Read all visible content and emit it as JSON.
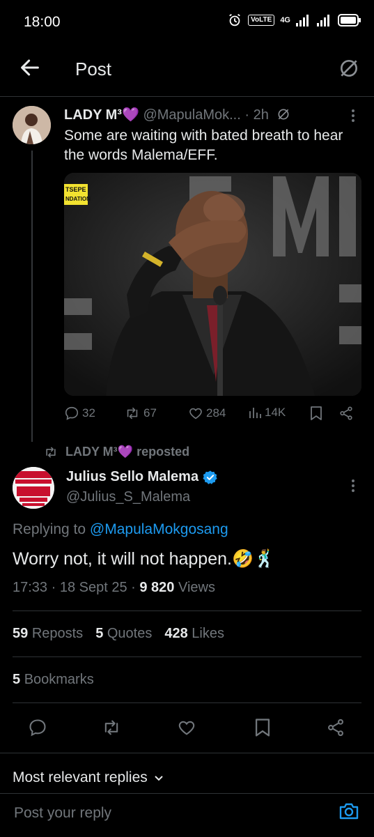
{
  "status": {
    "time": "18:00",
    "volte": "VoLTE",
    "net": "4G"
  },
  "header": {
    "title": "Post"
  },
  "parent": {
    "name": "LADY M³💜",
    "handle": "@MapulaMok...",
    "age": "· 2h",
    "text": "Some are waiting with bated breath to hear the words Malema/EFF.",
    "media_sign": "TSEPE\nNDATION",
    "replies": "32",
    "reposts": "67",
    "likes": "284",
    "views": "14K"
  },
  "repost_line": "LADY M³💜 reposted",
  "main": {
    "name": "Julius Sello Malema",
    "handle": "@Julius_S_Malema",
    "replying_prefix": "Replying to",
    "replying_to": "@MapulaMokgosang",
    "text": "Worry not, it will not happen.🤣🕺",
    "time": "17:33 · 18 Sept 25 ·",
    "views_num": "9 820",
    "views_label": "Views",
    "avatar_text": "EFF 10th ANNIVERSARY RALLY",
    "stats": {
      "reposts_num": "59",
      "reposts_label": "Reposts",
      "quotes_num": "5",
      "quotes_label": "Quotes",
      "likes_num": "428",
      "likes_label": "Likes"
    },
    "bookmarks_num": "5",
    "bookmarks_label": "Bookmarks"
  },
  "replies_filter": "Most relevant replies",
  "reply_placeholder": "Post your reply",
  "colors": {
    "accent": "#1d9bf0",
    "muted": "#71767b",
    "bg": "#000000",
    "text": "#e7e9ea"
  }
}
